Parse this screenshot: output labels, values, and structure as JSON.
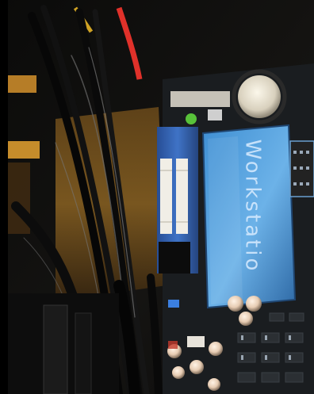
{
  "photo": {
    "subject": "motherboard-interior",
    "heatsink_text": "Workstatio"
  }
}
